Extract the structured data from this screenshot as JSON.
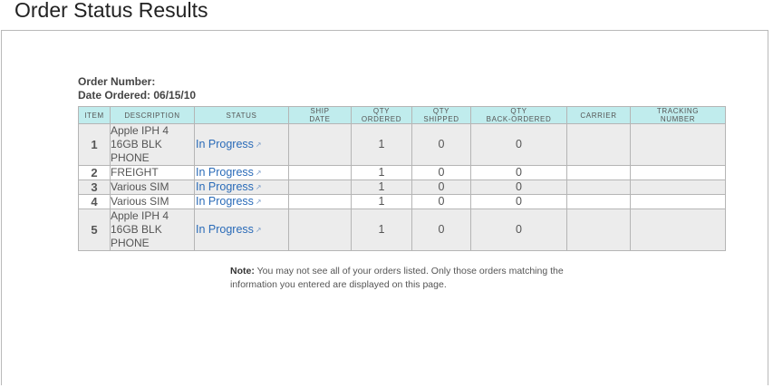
{
  "page": {
    "title": "Order Status Results"
  },
  "order": {
    "number_label": "Order Number:",
    "number_value": "",
    "date_label": "Date Ordered:",
    "date_value": "06/15/10"
  },
  "table": {
    "headers": {
      "item": "ITEM",
      "description": "DESCRIPTION",
      "status": "STATUS",
      "ship_date_1": "SHIP",
      "ship_date_2": "DATE",
      "qty_ordered_1": "QTY",
      "qty_ordered_2": "ORDERED",
      "qty_shipped_1": "QTY",
      "qty_shipped_2": "SHIPPED",
      "qty_back_1": "QTY",
      "qty_back_2": "BACK-ORDERED",
      "carrier": "CARRIER",
      "tracking_1": "TRACKING",
      "tracking_2": "NUMBER"
    },
    "rows": [
      {
        "item": "1",
        "description": "Apple IPH 4 16GB BLK PHONE",
        "status": "In Progress",
        "ship_date": "",
        "qty_ordered": "1",
        "qty_shipped": "0",
        "qty_back": "0",
        "carrier": "",
        "tracking": ""
      },
      {
        "item": "2",
        "description": "FREIGHT",
        "status": "In Progress",
        "ship_date": "",
        "qty_ordered": "1",
        "qty_shipped": "0",
        "qty_back": "0",
        "carrier": "",
        "tracking": ""
      },
      {
        "item": "3",
        "description": "Various SIM",
        "status": "In Progress",
        "ship_date": "",
        "qty_ordered": "1",
        "qty_shipped": "0",
        "qty_back": "0",
        "carrier": "",
        "tracking": ""
      },
      {
        "item": "4",
        "description": "Various SIM",
        "status": "In Progress",
        "ship_date": "",
        "qty_ordered": "1",
        "qty_shipped": "0",
        "qty_back": "0",
        "carrier": "",
        "tracking": ""
      },
      {
        "item": "5",
        "description": "Apple IPH 4 16GB BLK PHONE",
        "status": "In Progress",
        "ship_date": "",
        "qty_ordered": "1",
        "qty_shipped": "0",
        "qty_back": "0",
        "carrier": "",
        "tracking": ""
      }
    ]
  },
  "note": {
    "label": "Note:",
    "text": "You may not see all of your orders listed. Only those orders matching the information you entered are displayed on this page."
  },
  "icons": {
    "status_link": "external-link-icon"
  },
  "colors": {
    "header_bg": "#c0eced",
    "link": "#2a6bb8",
    "row_alt": "#ececec"
  }
}
